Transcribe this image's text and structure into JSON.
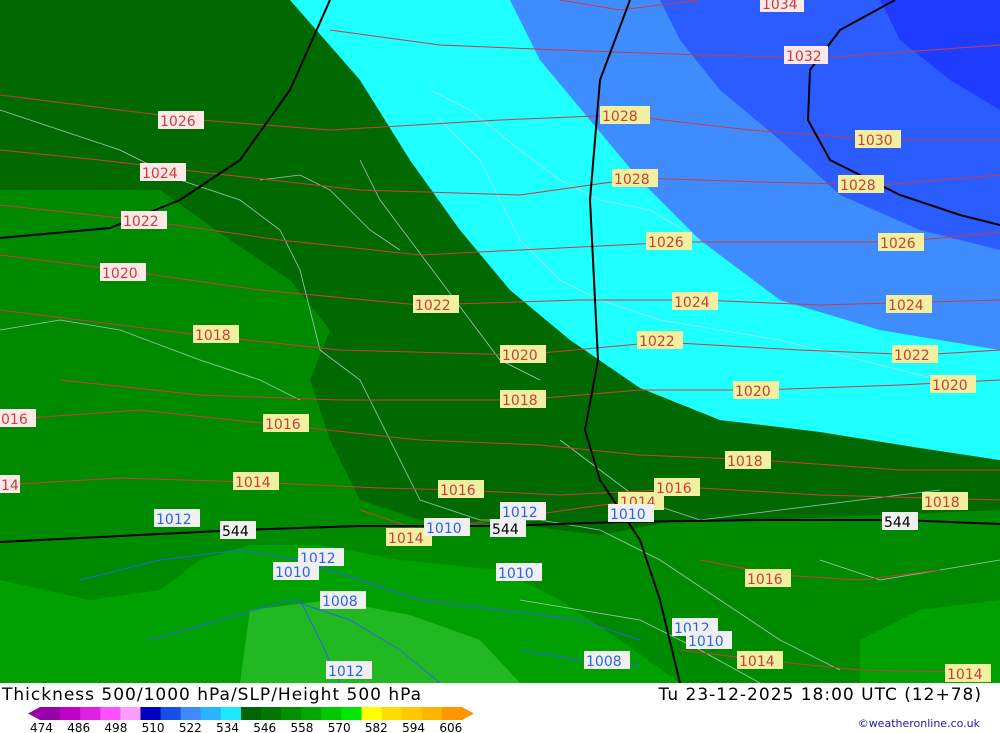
{
  "title": "Thickness 500/1000 hPa/SLP/Height 500 hPa",
  "datetime": "Tu 23-12-2025 18:00 UTC (12+78)",
  "credit": "©weatheronline.co.uk",
  "legend": {
    "ticks": [
      "474",
      "486",
      "498",
      "510",
      "522",
      "534",
      "546",
      "558",
      "570",
      "582",
      "594",
      "606"
    ],
    "colors": [
      "#9a00a8",
      "#c000c8",
      "#e020e0",
      "#ff50ff",
      "#ff9cff",
      "#0000c0",
      "#1450e8",
      "#3c8cff",
      "#28b4ff",
      "#1ee8ff",
      "#006400",
      "#007800",
      "#009000",
      "#00a800",
      "#00c800",
      "#00e600",
      "#ffff00",
      "#ffdc00",
      "#ffc800",
      "#ffb400",
      "#ff9600"
    ]
  },
  "map": {
    "band_colors": {
      "blue_dark": "#2a5cff",
      "blue_mid": "#3f8cff",
      "blue_light": "#2ab4ff",
      "cyan": "#1effff",
      "green_dark": "#006a00",
      "green_mid": "#008a00",
      "green_light": "#00a000",
      "green_pale": "#22b822"
    },
    "isobar_color": "#cc3c3c",
    "isobar_labels_red": [
      "1034",
      "1032",
      "1026",
      "1024",
      "1022",
      "1020",
      "1018",
      "1016",
      "016",
      "14",
      "1014",
      "1016"
    ],
    "isobar_labels_yellow": [
      "1030",
      "1028",
      "1028",
      "1026",
      "1026",
      "1024",
      "1024",
      "1022",
      "1022",
      "1022",
      "1020",
      "1020",
      "1020",
      "1018",
      "1018",
      "1018",
      "1016",
      "1016",
      "1014",
      "1014",
      "1014",
      "1012",
      "1018",
      "1016",
      "1014",
      "1014"
    ],
    "blue_labels": [
      "1012",
      "1010",
      "1012",
      "1010",
      "1008",
      "1010",
      "1010",
      "1012",
      "1010",
      "1008",
      "1012",
      "1010",
      "1008",
      "1010"
    ],
    "height_labels": [
      "544",
      "544",
      "544"
    ]
  }
}
